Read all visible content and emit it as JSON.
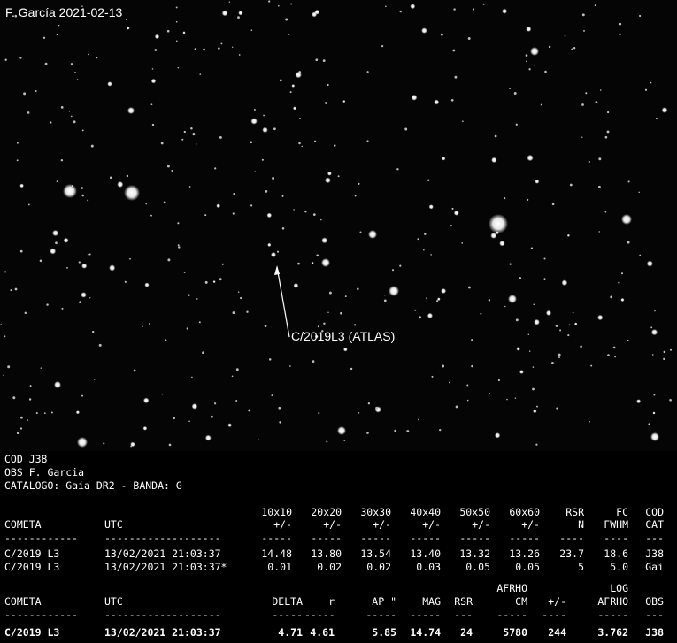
{
  "image_overlay": {
    "title": "F. García  2021-02-13",
    "target_label": "C/2019L3 (ATLAS)"
  },
  "report": {
    "header": [
      "COD J38",
      "OBS F. Garcia",
      "CATALOGO: Gaia DR2 - BANDA: G"
    ],
    "table1": {
      "headers_top": [
        "",
        "",
        "10x10",
        "20x20",
        "30x30",
        "40x40",
        "50x50",
        "60x60",
        "RSR",
        "FC",
        "COD"
      ],
      "headers_bottom": [
        "COMETA",
        "UTC",
        "+/-",
        "+/-",
        "+/-",
        "+/-",
        "+/-",
        "+/-",
        "N",
        "FWHM",
        "CAT"
      ],
      "dashes": [
        "------------",
        "-------------------",
        "-----",
        "-----",
        "-----",
        "-----",
        "-----",
        "-----",
        "----",
        "----",
        "---"
      ],
      "rows": [
        [
          "C/2019 L3",
          "13/02/2021 21:03:37",
          "14.48",
          "13.80",
          "13.54",
          "13.40",
          "13.32",
          "13.26",
          "23.7",
          "18.6",
          "J38"
        ],
        [
          "C/2019 L3",
          "13/02/2021 21:03:37*",
          "0.01",
          "0.02",
          "0.02",
          "0.03",
          "0.05",
          "0.05",
          "5",
          "5.0",
          "Gai"
        ]
      ]
    },
    "table2": {
      "headers_top": [
        "",
        "",
        "",
        "",
        "",
        "",
        "",
        "AFRHO",
        "",
        "LOG",
        ""
      ],
      "headers_bottom": [
        "COMETA",
        "UTC",
        "DELTA",
        "r",
        "AP \"",
        "MAG",
        "RSR",
        "CM",
        "+/-",
        "AFRHO",
        "OBS"
      ],
      "dashes": [
        "------------",
        "-------------------",
        "-----",
        "-----",
        "-----",
        "-----",
        "---",
        "-----",
        "----",
        "-----",
        "---"
      ],
      "row": [
        "C/2019 L3",
        "13/02/2021 21:03:37",
        "4.71",
        "4.61",
        "5.85",
        "14.74",
        "24",
        "5780",
        "244",
        "3.762",
        "J38"
      ]
    }
  }
}
